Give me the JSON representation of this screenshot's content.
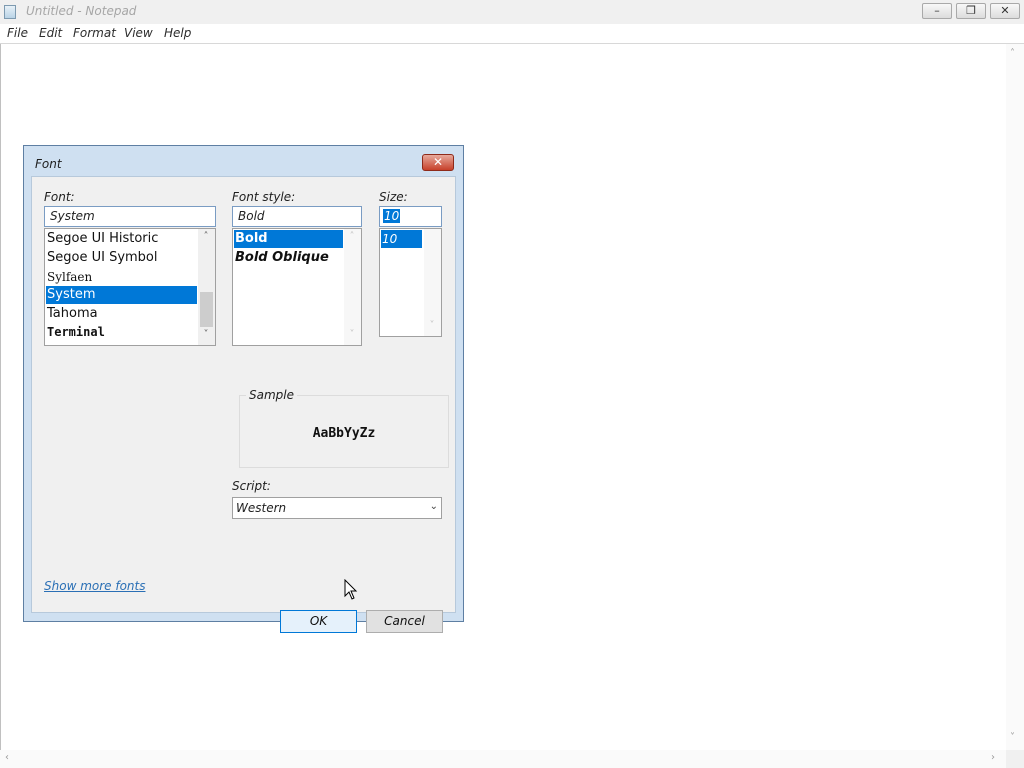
{
  "window": {
    "title": "Untitled - Notepad",
    "minimize_glyph": "–",
    "maximize_glyph": "❐",
    "close_glyph": "✕"
  },
  "menu": [
    "File",
    "Edit",
    "Format",
    "View",
    "Help"
  ],
  "dialog": {
    "title": "Font",
    "close_glyph": "✕",
    "font_label": "Font:",
    "font_value": "System",
    "font_list": [
      {
        "label": "Segoe UI Historic",
        "selected": false
      },
      {
        "label": "Segoe UI Symbol",
        "selected": false
      },
      {
        "label": "Sylfaen",
        "selected": false
      },
      {
        "label": "System",
        "selected": true
      },
      {
        "label": "Tahoma",
        "selected": false
      },
      {
        "label": "Terminal",
        "selected": false
      }
    ],
    "style_label": "Font style:",
    "style_value": "Bold",
    "style_list": [
      {
        "label": "Bold",
        "selected": true
      },
      {
        "label": "Bold Oblique",
        "selected": false
      }
    ],
    "size_label": "Size:",
    "size_value": "10",
    "size_list": [
      {
        "label": "10",
        "selected": true
      }
    ],
    "sample_label": "Sample",
    "sample_text": "AaBbYyZz",
    "script_label": "Script:",
    "script_value": "Western",
    "show_more_fonts": "Show more fonts",
    "ok_label": "OK",
    "cancel_label": "Cancel",
    "selection_color": "#0078d7"
  },
  "icons": {
    "up_arrow": "˄",
    "down_arrow": "˅",
    "left_arrow": "‹",
    "right_arrow": "›",
    "combo_arrow": "⌄"
  }
}
